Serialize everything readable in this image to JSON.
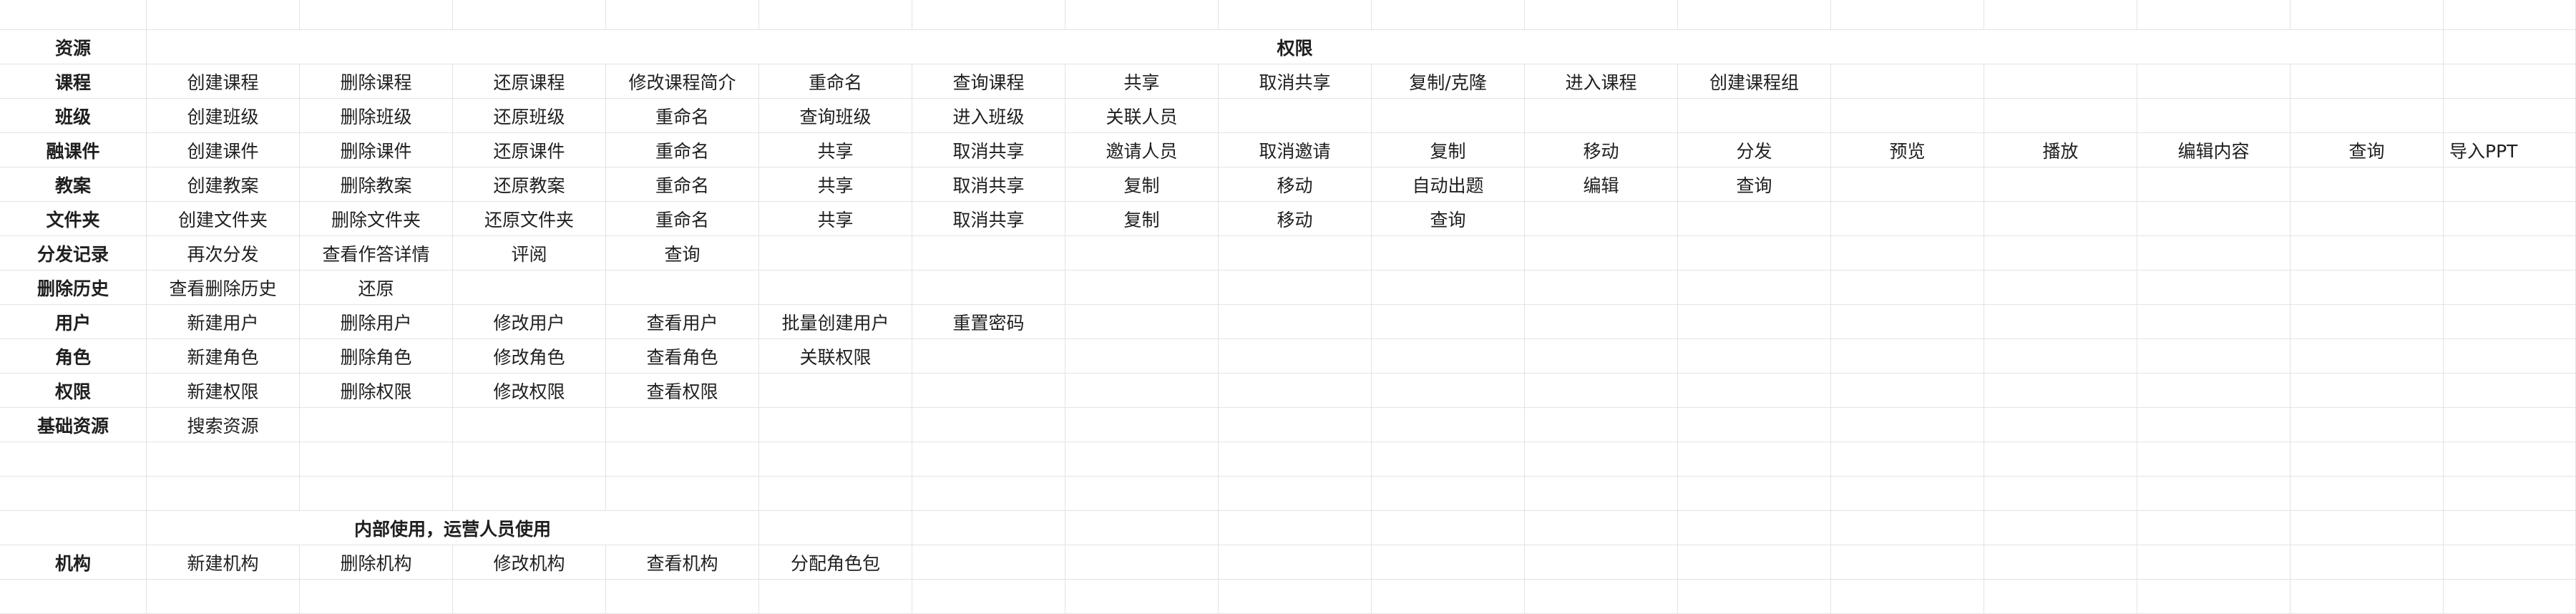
{
  "header": {
    "resource_label": "资源",
    "permission_label": "权限"
  },
  "internal_note": "内部使用，运营人员使用",
  "rows": [
    {
      "resource": "课程",
      "actions": [
        "创建课程",
        "删除课程",
        "还原课程",
        "修改课程简介",
        "重命名",
        "查询课程",
        "共享",
        "取消共享",
        "复制/克隆",
        "进入课程",
        "创建课程组"
      ]
    },
    {
      "resource": "班级",
      "actions": [
        "创建班级",
        "删除班级",
        "还原班级",
        "重命名",
        "查询班级",
        "进入班级",
        "关联人员"
      ]
    },
    {
      "resource": "融课件",
      "actions": [
        "创建课件",
        "删除课件",
        "还原课件",
        "重命名",
        "共享",
        "取消共享",
        "邀请人员",
        "取消邀请",
        "复制",
        "移动",
        "分发",
        "预览",
        "播放",
        "编辑内容",
        "查询",
        "导入PPT"
      ]
    },
    {
      "resource": "教案",
      "actions": [
        "创建教案",
        "删除教案",
        "还原教案",
        "重命名",
        "共享",
        "取消共享",
        "复制",
        "移动",
        "自动出题",
        "编辑",
        "查询"
      ]
    },
    {
      "resource": "文件夹",
      "actions": [
        "创建文件夹",
        "删除文件夹",
        "还原文件夹",
        "重命名",
        "共享",
        "取消共享",
        "复制",
        "移动",
        "查询"
      ]
    },
    {
      "resource": "分发记录",
      "actions": [
        "再次分发",
        "查看作答详情",
        "评阅",
        "查询"
      ]
    },
    {
      "resource": "删除历史",
      "actions": [
        "查看删除历史",
        "还原"
      ]
    },
    {
      "resource": "用户",
      "actions": [
        "新建用户",
        "删除用户",
        "修改用户",
        "查看用户",
        "批量创建用户",
        "重置密码"
      ]
    },
    {
      "resource": "角色",
      "actions": [
        "新建角色",
        "删除角色",
        "修改角色",
        "查看角色",
        "关联权限"
      ]
    },
    {
      "resource": "权限",
      "actions": [
        "新建权限",
        "删除权限",
        "修改权限",
        "查看权限"
      ]
    },
    {
      "resource": "基础资源",
      "actions": [
        "搜索资源"
      ]
    }
  ],
  "org_row": {
    "resource": "机构",
    "actions": [
      "新建机构",
      "删除机构",
      "修改机构",
      "查看机构",
      "分配角色包"
    ]
  }
}
